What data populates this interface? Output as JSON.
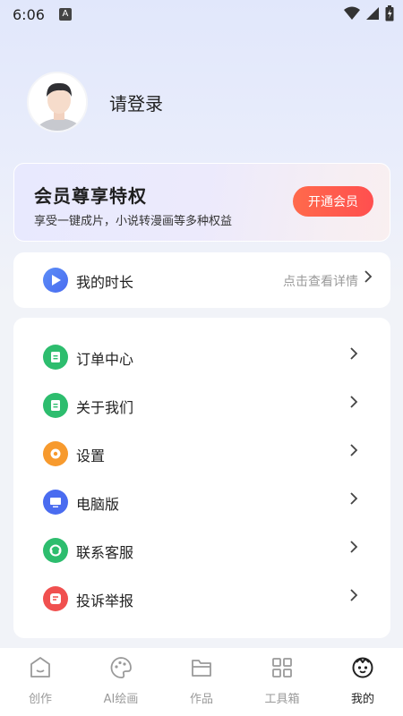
{
  "status_bar": {
    "time": "6:06",
    "indicator": "A"
  },
  "profile": {
    "login_text": "请登录"
  },
  "vip": {
    "title": "会员尊享特权",
    "subtitle": "享受一键成片，小说转漫画等多种权益",
    "button": "开通会员"
  },
  "duration": {
    "label": "我的时长",
    "detail": "点击查看详情"
  },
  "menu": {
    "items": [
      {
        "label": "订单中心",
        "icon": "order-icon",
        "color": "#2dbd6e"
      },
      {
        "label": "关于我们",
        "icon": "about-icon",
        "color": "#2dbd6e"
      },
      {
        "label": "设置",
        "icon": "settings-icon",
        "color": "#f79a2e"
      },
      {
        "label": "电脑版",
        "icon": "desktop-icon",
        "color": "#4a6cf0"
      },
      {
        "label": "联系客服",
        "icon": "customer-service-icon",
        "color": "#2dbd6e"
      },
      {
        "label": "投诉举报",
        "icon": "report-icon",
        "color": "#f0504f"
      }
    ]
  },
  "tabs": [
    {
      "label": "创作",
      "icon": "create-icon"
    },
    {
      "label": "AI绘画",
      "icon": "palette-icon"
    },
    {
      "label": "作品",
      "icon": "folder-icon"
    },
    {
      "label": "工具箱",
      "icon": "grid-icon"
    },
    {
      "label": "我的",
      "icon": "profile-face-icon",
      "active": true
    }
  ],
  "colors": {
    "accent": "#ff5a4e",
    "active_tab": "#222222",
    "inactive_tab": "#9a9a9a"
  }
}
